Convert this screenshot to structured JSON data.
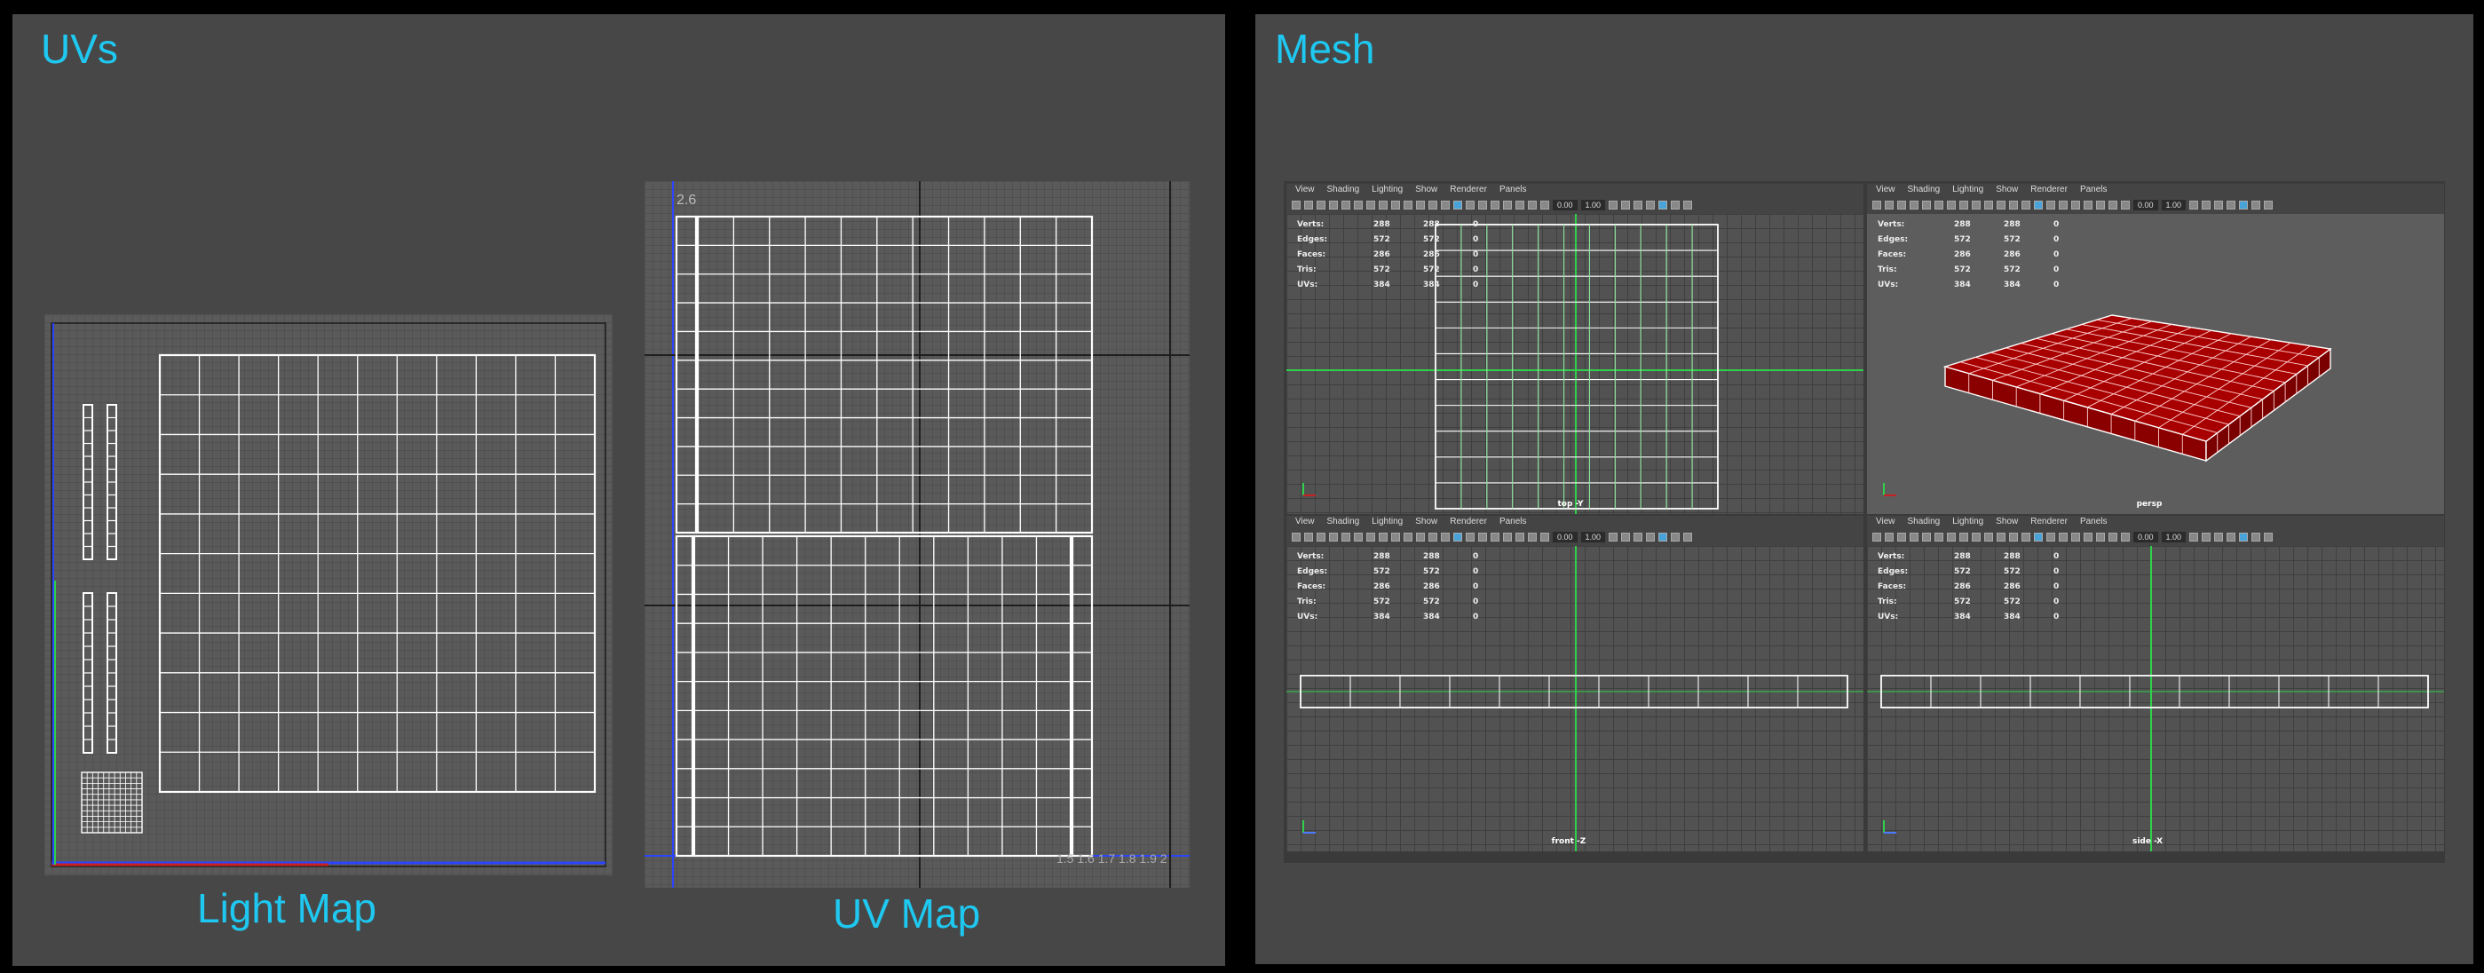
{
  "uvs_panel": {
    "title": "UVs"
  },
  "mesh_panel": {
    "title": "Mesh"
  },
  "light_map": {
    "caption": "Light Map"
  },
  "uv_map": {
    "caption": "UV Map",
    "top_label": "2.6",
    "x_tick_labels": "1.5 1.6 1.7 1.8 1.9 2"
  },
  "viewport_menu": [
    "View",
    "Shading",
    "Lighting",
    "Show",
    "Renderer",
    "Panels"
  ],
  "toolbar_fields": {
    "value_a": "0.00",
    "value_b": "1.00"
  },
  "hud": {
    "rows": [
      {
        "label": "Verts:",
        "a": "288",
        "b": "288",
        "c": "0"
      },
      {
        "label": "Edges:",
        "a": "572",
        "b": "572",
        "c": "0"
      },
      {
        "label": "Faces:",
        "a": "286",
        "b": "286",
        "c": "0"
      },
      {
        "label": "Tris:",
        "a": "572",
        "b": "572",
        "c": "0"
      },
      {
        "label": "UVs:",
        "a": "384",
        "b": "384",
        "c": "0"
      }
    ]
  },
  "viewports": {
    "top": {
      "camera": "top -Y"
    },
    "persp": {
      "camera": "persp"
    },
    "front": {
      "camera": "front -Z"
    },
    "side": {
      "camera": "side -X"
    }
  },
  "colors": {
    "accent": "#1ec8f0",
    "mesh_red": "#a80000",
    "grid_green": "#2fd04a"
  }
}
